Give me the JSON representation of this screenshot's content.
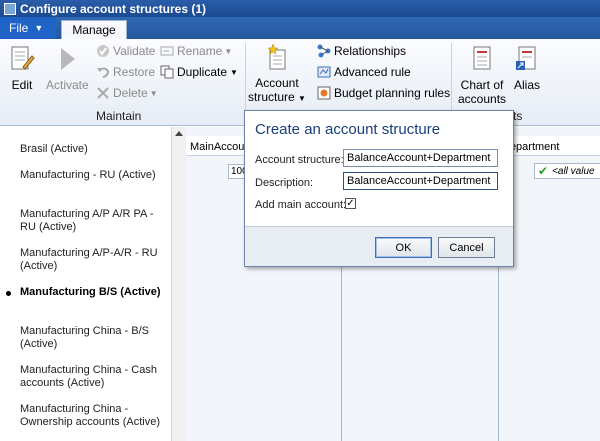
{
  "window": {
    "title": "Configure account structures (1)"
  },
  "tabs": {
    "file": "File",
    "manage": "Manage"
  },
  "ribbon": {
    "edit": "Edit",
    "activate": "Activate",
    "validate": "Validate",
    "restore": "Restore",
    "delete": "Delete",
    "rename": "Rename",
    "duplicate": "Duplicate",
    "maintain_group": "Maintain",
    "account_structure_line1": "Account",
    "account_structure_line2": "structure",
    "relationships": "Relationships",
    "advanced_rule": "Advanced rule",
    "budget_planning_rules": "Budget planning rules",
    "chart_of_accounts_line1": "Chart of",
    "chart_of_accounts_line2": "accounts",
    "alias": "Alias",
    "partial_group_label": "ts"
  },
  "left_list": {
    "items": [
      {
        "label": "Brasil (Active)"
      },
      {
        "label": "Manufacturing - RU (Active)"
      },
      {
        "label": "Manufacturing A/P A/R PA - RU (Active)"
      },
      {
        "label": "Manufacturing A/P-A/R - RU (Active)"
      },
      {
        "label": "Manufacturing B/S (Active)"
      },
      {
        "label": "Manufacturing China - B/S (Active)"
      },
      {
        "label": "Manufacturing China - Cash accounts (Active)"
      },
      {
        "label": "Manufacturing China - Ownership accounts (Active)"
      }
    ],
    "selected_index": 4
  },
  "grid": {
    "col_main": "MainAccoun",
    "col_department": "Department",
    "cell_main_value": "100",
    "cell_all_values": "<all value"
  },
  "dialog": {
    "title": "Create an account structure",
    "account_structure_label": "Account structure:",
    "account_structure_value": "BalanceAccount+Department",
    "description_label": "Description:",
    "description_value": "BalanceAccount+Department",
    "add_main_account_label": "Add main account:",
    "add_main_account_checked": true,
    "ok": "OK",
    "cancel": "Cancel"
  }
}
